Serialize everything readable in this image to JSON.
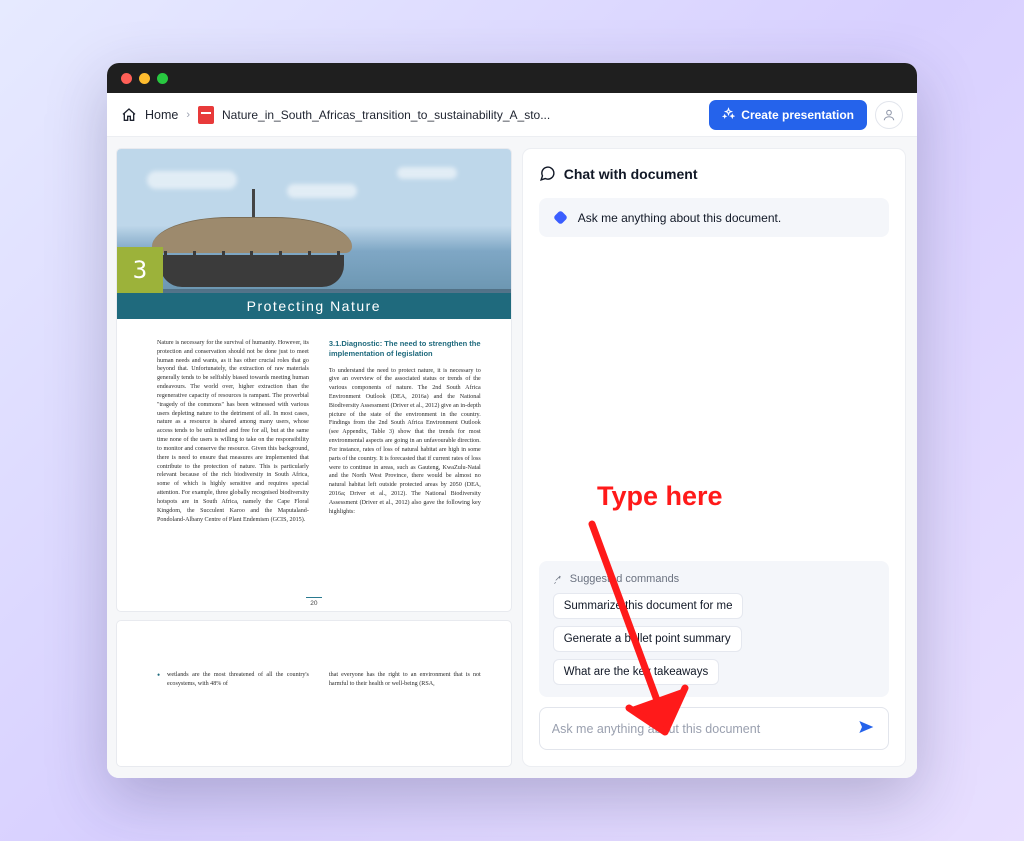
{
  "breadcrumb": {
    "home": "Home",
    "filename": "Nature_in_South_Africas_transition_to_sustainability_A_sto..."
  },
  "header": {
    "create_btn": "Create presentation"
  },
  "doc": {
    "chapter_num": "3",
    "chapter_title": "Protecting Nature",
    "pnum1": "20",
    "col1": "Nature is necessary for the survival of humanity. However, its protection and conservation should not be done just to meet human needs and wants, as it has other crucial roles that go beyond that. Unfortunately, the extraction of raw materials generally tends to be selfishly biased towards meeting human endeavours. The world over, higher extraction than the regenerative capacity of resources is rampant. The proverbial \"tragedy of the commons\" has been witnessed with various users depleting nature to the detriment of all. In most cases, nature as a resource is shared among many users, whose access tends to be unlimited and free for all, but at the same time none of the users is willing to take on the responsibility to monitor and conserve the resource. Given this background, there is need to ensure that measures are implemented that contribute to the protection of nature. This is particularly relevant because of the rich biodiversity in South Africa, some of which is highly sensitive and requires special attention. For example, three globally recognised biodiversity hotspots are in South Africa, namely the Cape Floral Kingdom, the Succulent Karoo and the Maputaland-Pondoland-Albany Centre of Plant Endemism (GCIS, 2015).",
    "h31": "3.1.Diagnostic: The need to strengthen the implementation of legislation",
    "col2": "To understand the need to protect nature, it is necessary to give an overview of the associated status or trends of the various components of nature. The 2nd South Africa Environment Outlook (DEA, 2016a) and the National Biodiversity Assessment (Driver et al., 2012) give an in-depth picture of the state of the environment in the country. Findings from the 2nd South Africa Environment Outlook (see Appendix, Table 3) show that the trends for most environmental aspects are going in an unfavourable direction. For instance, rates of loss of natural habitat are high in some parts of the country. It is forecasted that if current rates of loss were to continue in areas, such as Gauteng, KwaZulu-Natal and the North West Province, there would be almost no natural habitat left outside protected areas by 2050 (DEA, 2016a; Driver et al., 2012). The National Biodiversity Assessment (Driver et al., 2012) also gave the following key highlights:",
    "p2c1": "wetlands are the most threatened of all the country's ecosystems, with 48% of",
    "p2c2": "that everyone has the right to an environment that is not harmful to their health or well-being (RSA,"
  },
  "chat": {
    "title": "Chat with document",
    "greeting": "Ask me anything about this document.",
    "sugg_label": "Suggested commands",
    "chips": {
      "c1": "Summarize this document for me",
      "c2": "Generate a bullet point summary",
      "c3": "What are the key takeaways"
    },
    "placeholder": "Ask me anything about this document"
  },
  "annotation": {
    "text": "Type here"
  }
}
